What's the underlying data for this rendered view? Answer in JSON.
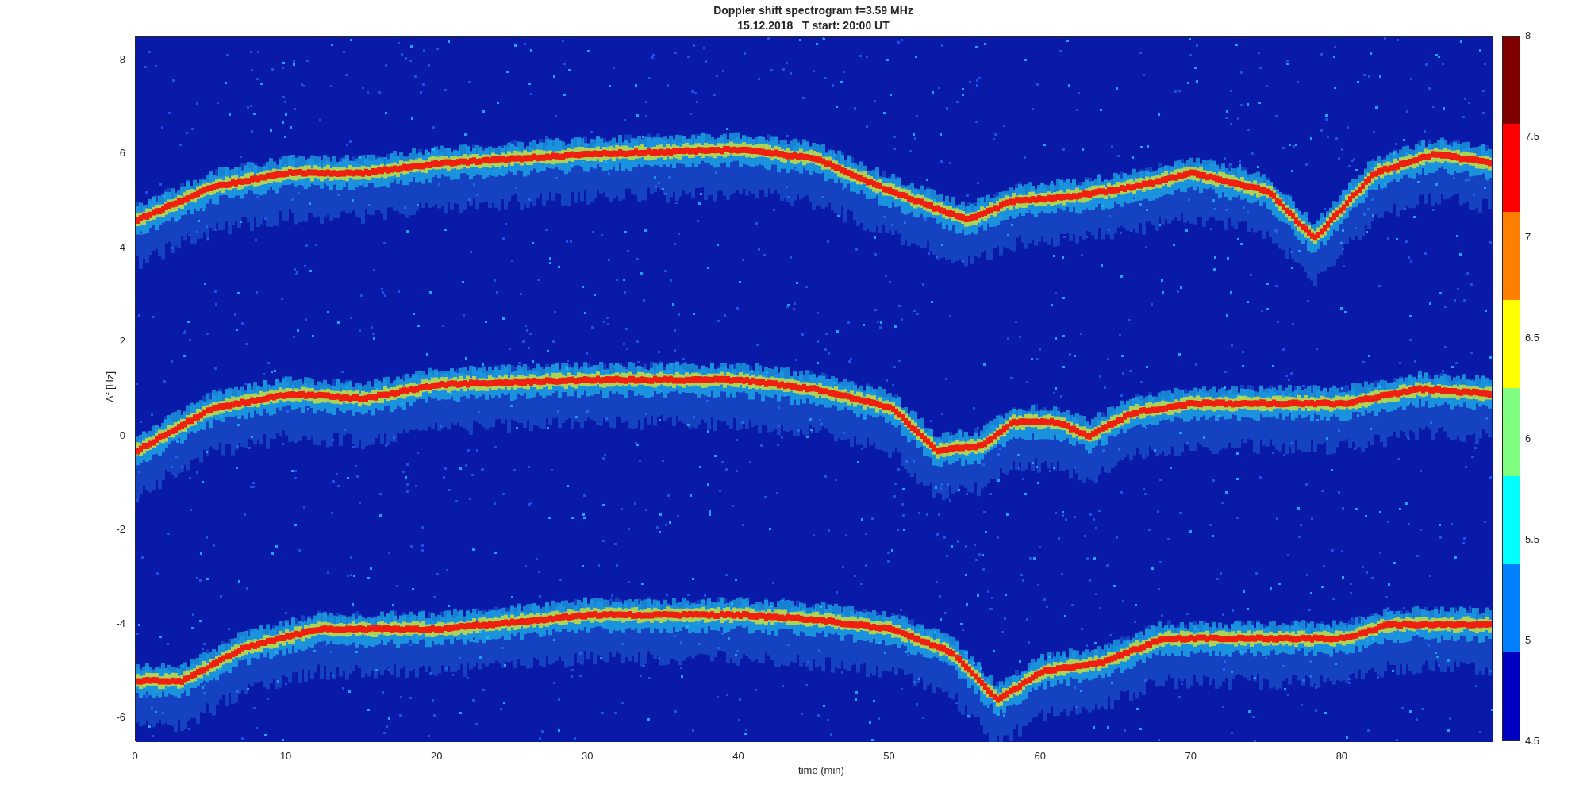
{
  "figure": {
    "title_lines": [
      "Doppler shift spectrogram f=3.59 MHz",
      "15.12.2018   T start: 20:00 UT"
    ],
    "xlabel": "time (min)",
    "ylabel": "Δf [Hz]",
    "xticks": [
      "0",
      "10",
      "20",
      "30",
      "40",
      "50",
      "60",
      "70",
      "80"
    ],
    "yticks": [
      "8",
      "6",
      "4",
      "2",
      "0",
      "-2",
      "-4",
      "-6"
    ],
    "colorbar_ticks": [
      "8",
      "7.5",
      "7",
      "6.5",
      "6",
      "5.5",
      "5",
      "4.5"
    ]
  }
}
